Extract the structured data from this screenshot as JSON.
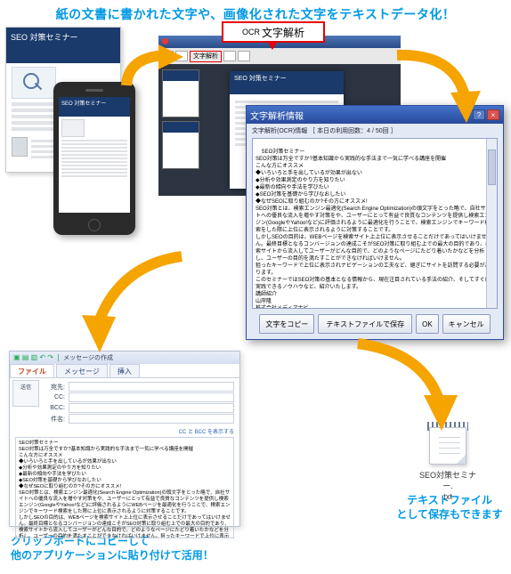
{
  "headline": "紙の文書に書かれた文字や、画像化された文字をテキストデータ化！",
  "ocr_label_small": "OCR",
  "ocr_label": "文字解析",
  "doc_title": "SEO 対策セミナー",
  "phone_title": "SEO 対策セミナー",
  "editor": {
    "toolbar_ocr": "文字解析",
    "page_title": "SEO 対策セミナー"
  },
  "dialog": {
    "title": "文字解析情報",
    "info_prefix": "文字解析(OCR)情報",
    "info_count": "［ 本日の利用回数：4 / 50回 ］",
    "text": "SEO対策セミナー\nSEO対策は万全ですか?基本知識から実践的な手法まで一気に学べる講座を開催\nこんな方にオススメ\n◆いろいろと手を出しているが効果が出ない\n◆分析や効果測定のやり方を知りたい\n◆最新の傾向や手法を学びたい\n◆SEO対策を基礎から学びなおしたい\n◆なぜSEOに取り組むのか?その方にオススメ!\nSEO対策とは、検索エンジン最適化(Search Engine Optimization)の頭文字をとった略で、自社サイトへの優良な流入を増やす対策をや、ユーザーにとって有益で良質なコンテンツを提供し検索エンジン(GoogleやYahoo!など)に評価されるように最適化を行うことで、検索エンジンでキーワード検索をした際に上位に表示されるように対策することです。\nしかしSEOの目的は、WEBページを検索サイト上上位に表示させることだけであってはいけません。最終目標となるコンバージョンの達成こそがSEO対策に取り組む上での最大の目的であり、検索サイトから流入してユーザーがどんな目的で、どのようなページにたどり着いたかなどを分析し、ユーザーの目的を満たすことができなければいけません。\n狙ったキーワードで上位に表示されナビゲーションの工夫など、継ぎにサイトを訪問する必要があります。\nこのセミナーではSEO対策の基本となる情報から、現在注目されている手法の紹介、そしてすぐに実践できるノウハウなど、紹介いたします。\n講師紹介\n山岸隆\n株式会社メディアナビ",
    "btn_copy": "文字をコピー",
    "btn_save": "テキストファイルで保存",
    "btn_ok": "OK",
    "btn_cancel": "キャンセル"
  },
  "mail": {
    "window_title": "メッセージの作成",
    "tab_file": "ファイル",
    "tab_msg": "メッセージ",
    "tab_ins": "挿入",
    "send": "送信",
    "to": "宛先:",
    "cc": "CC:",
    "bcc": "BCC:",
    "subj": "件名:",
    "cclink": "CC と BCC を表示する",
    "body": "SEO対策セミナー\nSEO対策は万全ですか?基本知識から実践的な手法まで一気に学べる講座を開催\nこんな方にオススメ\n◆いろいろと手を出しているが効果が出ない\n◆分析や効果測定のやり方を知りたい\n◆最新の傾向や手法を学びたい\n◆SEO対策を基礎から学びなおしたい\n◆なぜSEOに取り組むのか?その方にオススメ!\nSEO対策とは、検索エンジン最適化(Search Engine Optimization)の頭文字をとった略で、自社サイトへの優良な流入を増やす対策をや、ユーザーにとって有益で良質なコンテンツを提供し検索エンジン(GoogleやYahoo!など)に評価されるようにWEBページを最適化を行うことで、検索エンジンでキーワード検索をした際に上位に表示されるように対策することです。\nしかしSEOの目的は、WEBページを検索サイト上上位に表示させることだけであってはいけません。最終目標となるコンバージョンの達成こそがSEO対策に取り組む上での最大の目的であり、検索サイトから流入してユーザーがどんな目的で、どのようなページにたどり着いたかなどを分析し、ユーザーの目的を満たすことができなければいけません。狙ったキーワードで上位に表示されたり、魅せるものなど、ユーザーの目的を満たすことに満足していただくために、サイトの運営や狙ったキーワードを移動しやすい構成、ナビゲーションの工夫など、継ぎにサイトを訪れてもらう必"
  },
  "txtfile": {
    "line1": "SEO対策セミナー.",
    "line2": "txt"
  },
  "caption_clipboard_l1": "クリップボードにコピーして",
  "caption_clipboard_l2": "他のアプリケーションに貼り付けて活用！",
  "caption_textfile_l1": "テキストファイル",
  "caption_textfile_l2": "として保存もできます"
}
